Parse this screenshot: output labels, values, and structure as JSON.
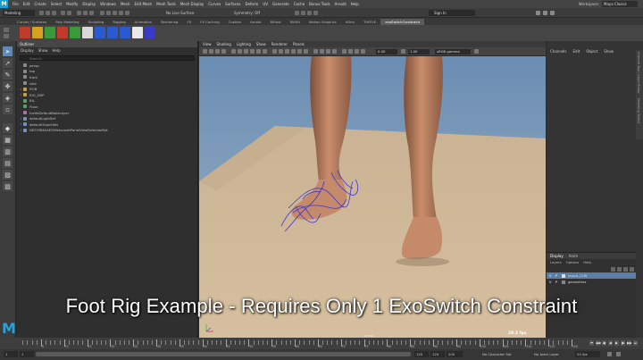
{
  "app": {
    "menus": [
      "File",
      "Edit",
      "Create",
      "Select",
      "Modify",
      "Display",
      "Windows",
      "Mesh",
      "Edit Mesh",
      "Mesh Tools",
      "Mesh Display",
      "Curves",
      "Surfaces",
      "Deform",
      "UV",
      "Generate",
      "Cache",
      "Bonus Tools",
      "Arnold",
      "Help"
    ],
    "workspace_label": "Workspace:",
    "workspace_value": "Maya Classic"
  },
  "status": {
    "mode": "Modeling",
    "no_live_surface": "No Live Surface",
    "symmetry": "Symmetry: Off",
    "sign_in": "Sign In"
  },
  "shelf": {
    "tabs": [
      "Curves / Surfaces",
      "Poly Modeling",
      "Sculpting",
      "Rigging",
      "Animation",
      "Rendering",
      "FX",
      "FX Caching",
      "Custom",
      "Arnold",
      "Bifrost",
      "MASH",
      "Motion Graphics",
      "XGen",
      "TURTLE",
      "exoSwitchConstraint"
    ],
    "active_tab": "exoSwitchConstraint",
    "icon_colors": [
      "#c23b2a",
      "#d8a020",
      "#3a9a3a",
      "#c23b2a",
      "#3a9a3a",
      "#d8d8d8",
      "#2a5ad0",
      "#2a5ad0",
      "#2a5ad0",
      "#e8e8e8",
      "#3a3ac8"
    ]
  },
  "outliner": {
    "title": "Outliner",
    "menu": [
      "Display",
      "Show",
      "Help"
    ],
    "search_placeholder": "Search...",
    "items": [
      {
        "label": "persp",
        "icon": "camera-icon",
        "expand": ""
      },
      {
        "label": "top",
        "icon": "camera-icon",
        "expand": ""
      },
      {
        "label": "front",
        "icon": "camera-icon",
        "expand": ""
      },
      {
        "label": "side",
        "icon": "camera-icon",
        "expand": ""
      },
      {
        "label": "ROB",
        "icon": "group-icon",
        "expand": "+"
      },
      {
        "label": "RIG_GRP",
        "icon": "group-icon",
        "expand": "+"
      },
      {
        "label": "BIL",
        "icon": "mesh-icon",
        "expand": ""
      },
      {
        "label": "Floor",
        "icon": "mesh-icon",
        "expand": ""
      },
      {
        "label": "turtleDefaultBakeLayer",
        "icon": "layer-icon",
        "expand": ""
      },
      {
        "label": "defaultLightSet",
        "icon": "set-icon",
        "expand": "+"
      },
      {
        "label": "defaultObjectSet",
        "icon": "set-icon",
        "expand": "+"
      },
      {
        "label": "DEFORMAGEOMetacodePanelViewSelectedSet",
        "icon": "set-icon",
        "expand": "+"
      }
    ]
  },
  "viewport": {
    "menus": [
      "View",
      "Shading",
      "Lighting",
      "Show",
      "Renderer",
      "Panels"
    ],
    "field_a": "0.00",
    "field_b": "1.00",
    "color_space": "sRGB gamma",
    "camera": "persp",
    "fps": "29.2 fps"
  },
  "channelbox": {
    "menu": [
      "Channels",
      "Edit",
      "Object",
      "Show"
    ],
    "side_tabs": [
      "Channel Box / Layer Editor",
      "Modeling Toolkit",
      "Attribute Editor"
    ]
  },
  "layers": {
    "tabs": [
      "Display",
      "Anim"
    ],
    "active_tab": "Display",
    "menu": [
      "Layers",
      "Options",
      "Help"
    ],
    "rows": [
      {
        "v": "V",
        "p": "P",
        "name": "layout_LOW",
        "selected": true
      },
      {
        "v": "V",
        "p": "P",
        "name": "geometries",
        "selected": false
      }
    ]
  },
  "timeline": {
    "numbers": [
      "5",
      "10",
      "15",
      "20",
      "25",
      "30",
      "35",
      "40",
      "45",
      "50",
      "55",
      "60",
      "65",
      "70",
      "75",
      "80",
      "85",
      "90",
      "95",
      "100",
      "105",
      "110",
      "115",
      "120"
    ],
    "buttons": [
      "⏮",
      "◀◀",
      "◀|",
      "◀",
      "▶",
      "|▶",
      "▶▶",
      "⏭"
    ]
  },
  "range": {
    "start": "1",
    "start2": "1",
    "end": "120",
    "end2": "120",
    "end3": "200",
    "char_set": "No Character Set",
    "anim_layer": "No Anim Layer",
    "fps": "24 fps"
  },
  "caption": "Foot Rig Example - Requires Only 1 ExoSwitch Constraint"
}
